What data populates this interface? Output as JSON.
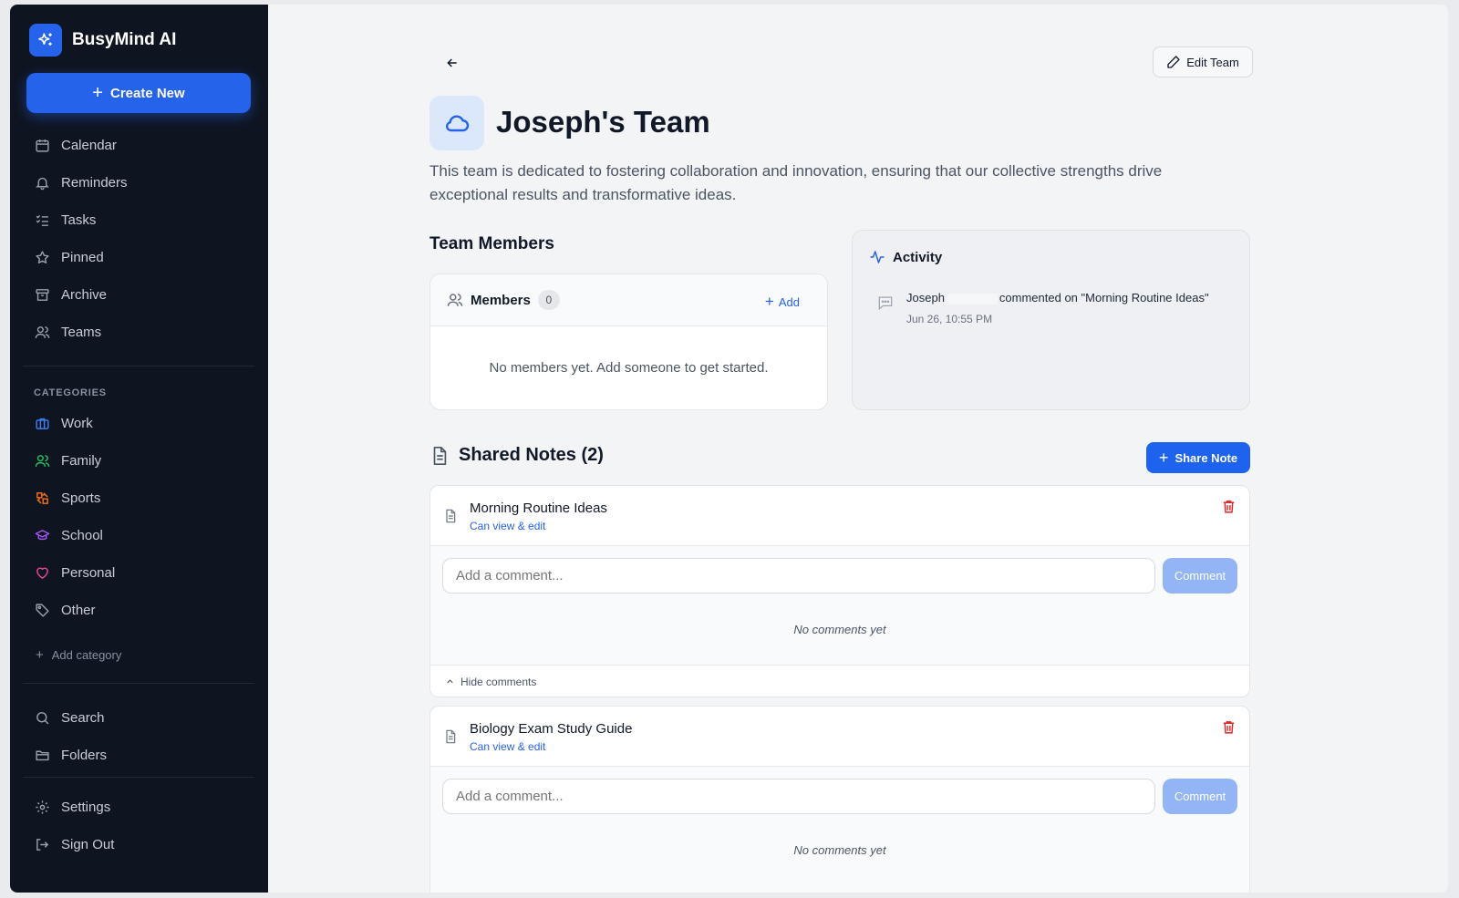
{
  "app": {
    "name": "BusyMind AI"
  },
  "sidebar": {
    "create_label": "Create New",
    "nav": [
      {
        "label": "Calendar",
        "icon": "calendar-icon"
      },
      {
        "label": "Reminders",
        "icon": "bell-icon"
      },
      {
        "label": "Tasks",
        "icon": "tasks-icon"
      },
      {
        "label": "Pinned",
        "icon": "star-icon"
      },
      {
        "label": "Archive",
        "icon": "archive-icon"
      },
      {
        "label": "Teams",
        "icon": "users-icon"
      }
    ],
    "categories_header": "CATEGORIES",
    "categories": [
      {
        "label": "Work",
        "icon": "briefcase-icon",
        "color": "#3b82f6"
      },
      {
        "label": "Family",
        "icon": "users-icon",
        "color": "#22c55e"
      },
      {
        "label": "Sports",
        "icon": "sports-icon",
        "color": "#f97316"
      },
      {
        "label": "School",
        "icon": "graduation-cap-icon",
        "color": "#a855f7"
      },
      {
        "label": "Personal",
        "icon": "heart-icon",
        "color": "#ec4899"
      },
      {
        "label": "Other",
        "icon": "tag-icon",
        "color": "#9ca3af"
      }
    ],
    "add_category": "Add category",
    "bottom_nav": [
      {
        "label": "Search",
        "icon": "search-icon"
      },
      {
        "label": "Folders",
        "icon": "folder-icon"
      }
    ],
    "footer_nav": [
      {
        "label": "Settings",
        "icon": "gear-icon"
      },
      {
        "label": "Sign Out",
        "icon": "sign-out-icon"
      }
    ]
  },
  "header": {
    "edit_label": "Edit Team"
  },
  "team": {
    "name": "Joseph's Team",
    "description": "This team is dedicated to fostering collaboration and innovation, ensuring that our collective strengths drive exceptional results and transformative ideas."
  },
  "members": {
    "section_title": "Team Members",
    "card_label": "Members",
    "count": "0",
    "add_label": "Add",
    "empty_text": "No members yet. Add someone to get started."
  },
  "activity": {
    "title": "Activity",
    "items": [
      {
        "user": "Joseph",
        "action": "commented on \"Morning Routine Ideas\"",
        "time": "Jun 26, 10:55 PM"
      }
    ]
  },
  "notes": {
    "title": "Shared Notes (2)",
    "share_label": "Share Note",
    "items": [
      {
        "title": "Morning Routine Ideas",
        "permission": "Can view & edit",
        "comment_placeholder": "Add a comment...",
        "comment_button": "Comment",
        "empty_comments": "No comments yet",
        "toggle_label": "Hide comments"
      },
      {
        "title": "Biology Exam Study Guide",
        "permission": "Can view & edit",
        "comment_placeholder": "Add a comment...",
        "comment_button": "Comment",
        "empty_comments": "No comments yet"
      }
    ]
  },
  "colors": {
    "accent": "#2563eb",
    "sidebar_bg": "#0f1421",
    "danger": "#dc2626"
  }
}
